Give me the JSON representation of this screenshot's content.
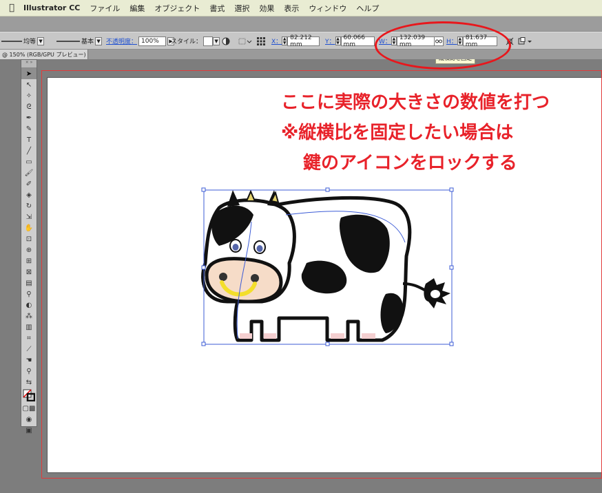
{
  "menubar": {
    "app_name": "Illustrator CC",
    "items": [
      "ファイル",
      "編集",
      "オブジェクト",
      "書式",
      "選択",
      "効果",
      "表示",
      "ウィンドウ",
      "ヘルプ"
    ]
  },
  "control_bar": {
    "stroke_profile": "均等",
    "brush": "基本",
    "opacity_label": "不透明度：",
    "opacity_value": "100%",
    "style_label": "スタイル：",
    "x_label": "X：",
    "x_value": "82.212 mm",
    "y_label": "Y：",
    "y_value": "60.066 mm",
    "w_label": "W：",
    "w_value": "132.039 mm",
    "h_label": "H：",
    "h_value": "81.637 mm"
  },
  "tooltip": {
    "text": "縦横比を固定"
  },
  "document_tab": {
    "label": "@ 150% (RGB/GPU プレビュー)"
  },
  "annotation": {
    "line1": "ここに実際の大きさの数値を打つ",
    "line2": "※縦横比を固定したい場合は",
    "line3": "鍵のアイコンをロックする",
    "color": "#e8222a"
  },
  "colors": {
    "menubar_bg": "#e9ecd3",
    "selection_blue": "#3b5bd6",
    "cow_nose": "#f6dcc8",
    "cow_mouth": "#f3de2c",
    "cow_hoof": "#f4cfd0"
  }
}
